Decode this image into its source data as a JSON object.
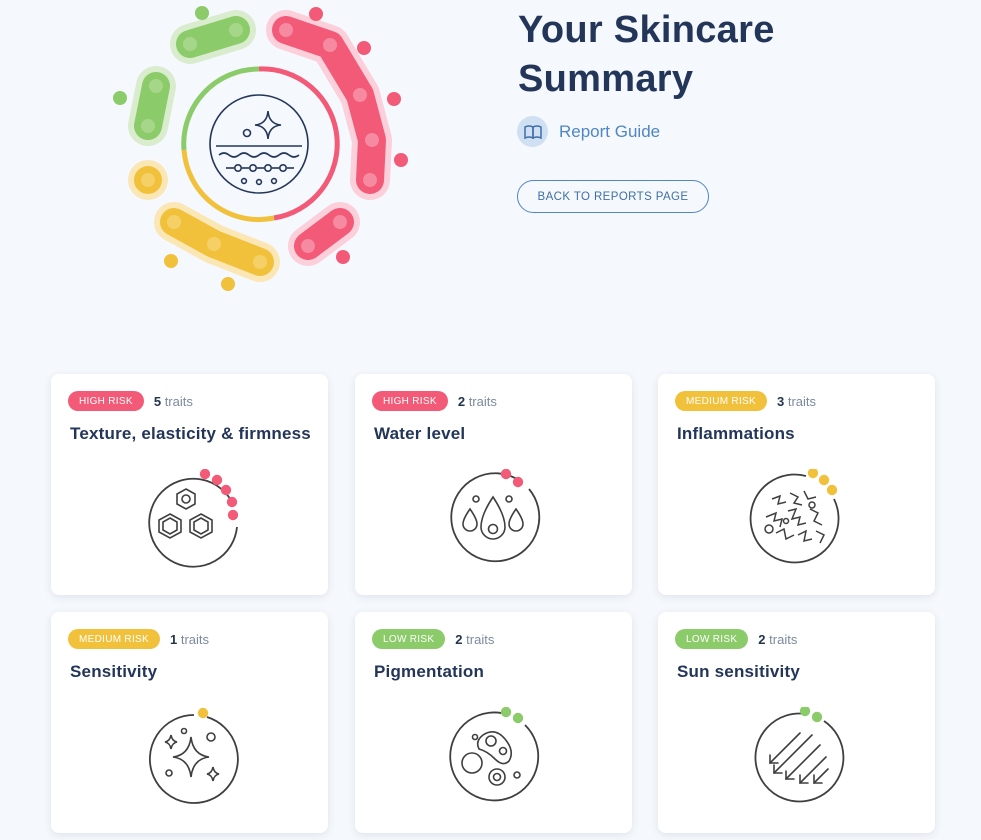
{
  "header": {
    "title_line1": "Your Skincare",
    "title_line2": "Summary",
    "guide_label": "Report Guide",
    "back_button": "BACK TO REPORTS PAGE"
  },
  "colors": {
    "high": "#f25a78",
    "medium": "#f2c13c",
    "low": "#8ccb69",
    "accent": "#4f86c6",
    "title": "#23365a"
  },
  "cards": [
    {
      "risk": "HIGH RISK",
      "level": "high",
      "count": "5",
      "traits_label": "traits",
      "title": "Texture, elasticity & firmness",
      "icon": "honeycomb-icon",
      "dots": 5
    },
    {
      "risk": "HIGH RISK",
      "level": "high",
      "count": "2",
      "traits_label": "traits",
      "title": "Water level",
      "icon": "water-drops-icon",
      "dots": 2
    },
    {
      "risk": "MEDIUM RISK",
      "level": "medium",
      "count": "3",
      "traits_label": "traits",
      "title": "Inflammations",
      "icon": "inflammation-icon",
      "dots": 3
    },
    {
      "risk": "MEDIUM RISK",
      "level": "medium",
      "count": "1",
      "traits_label": "traits",
      "title": "Sensitivity",
      "icon": "sparkles-icon",
      "dots": 1
    },
    {
      "risk": "LOW RISK",
      "level": "low",
      "count": "2",
      "traits_label": "traits",
      "title": "Pigmentation",
      "icon": "pigment-spots-icon",
      "dots": 2
    },
    {
      "risk": "LOW RISK",
      "level": "low",
      "count": "2",
      "traits_label": "traits",
      "title": "Sun sensitivity",
      "icon": "sun-rays-icon",
      "dots": 2
    }
  ]
}
